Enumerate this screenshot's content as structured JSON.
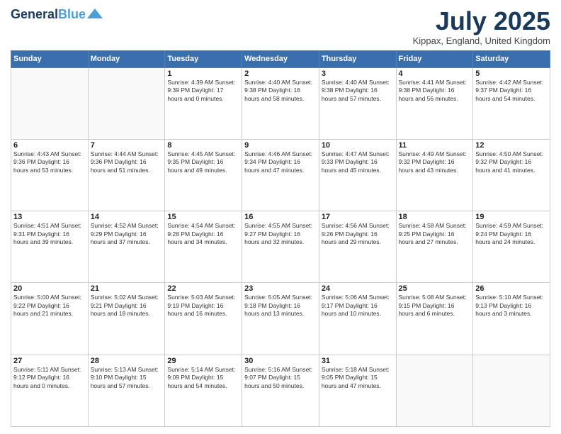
{
  "logo": {
    "line1": "General",
    "line2": "Blue"
  },
  "header": {
    "title": "July 2025",
    "location": "Kippax, England, United Kingdom"
  },
  "days_of_week": [
    "Sunday",
    "Monday",
    "Tuesday",
    "Wednesday",
    "Thursday",
    "Friday",
    "Saturday"
  ],
  "weeks": [
    [
      {
        "day": "",
        "text": ""
      },
      {
        "day": "",
        "text": ""
      },
      {
        "day": "1",
        "text": "Sunrise: 4:39 AM\nSunset: 9:39 PM\nDaylight: 17 hours\nand 0 minutes."
      },
      {
        "day": "2",
        "text": "Sunrise: 4:40 AM\nSunset: 9:38 PM\nDaylight: 16 hours\nand 58 minutes."
      },
      {
        "day": "3",
        "text": "Sunrise: 4:40 AM\nSunset: 9:38 PM\nDaylight: 16 hours\nand 57 minutes."
      },
      {
        "day": "4",
        "text": "Sunrise: 4:41 AM\nSunset: 9:38 PM\nDaylight: 16 hours\nand 56 minutes."
      },
      {
        "day": "5",
        "text": "Sunrise: 4:42 AM\nSunset: 9:37 PM\nDaylight: 16 hours\nand 54 minutes."
      }
    ],
    [
      {
        "day": "6",
        "text": "Sunrise: 4:43 AM\nSunset: 9:36 PM\nDaylight: 16 hours\nand 53 minutes."
      },
      {
        "day": "7",
        "text": "Sunrise: 4:44 AM\nSunset: 9:36 PM\nDaylight: 16 hours\nand 51 minutes."
      },
      {
        "day": "8",
        "text": "Sunrise: 4:45 AM\nSunset: 9:35 PM\nDaylight: 16 hours\nand 49 minutes."
      },
      {
        "day": "9",
        "text": "Sunrise: 4:46 AM\nSunset: 9:34 PM\nDaylight: 16 hours\nand 47 minutes."
      },
      {
        "day": "10",
        "text": "Sunrise: 4:47 AM\nSunset: 9:33 PM\nDaylight: 16 hours\nand 45 minutes."
      },
      {
        "day": "11",
        "text": "Sunrise: 4:49 AM\nSunset: 9:32 PM\nDaylight: 16 hours\nand 43 minutes."
      },
      {
        "day": "12",
        "text": "Sunrise: 4:50 AM\nSunset: 9:32 PM\nDaylight: 16 hours\nand 41 minutes."
      }
    ],
    [
      {
        "day": "13",
        "text": "Sunrise: 4:51 AM\nSunset: 9:31 PM\nDaylight: 16 hours\nand 39 minutes."
      },
      {
        "day": "14",
        "text": "Sunrise: 4:52 AM\nSunset: 9:29 PM\nDaylight: 16 hours\nand 37 minutes."
      },
      {
        "day": "15",
        "text": "Sunrise: 4:54 AM\nSunset: 9:28 PM\nDaylight: 16 hours\nand 34 minutes."
      },
      {
        "day": "16",
        "text": "Sunrise: 4:55 AM\nSunset: 9:27 PM\nDaylight: 16 hours\nand 32 minutes."
      },
      {
        "day": "17",
        "text": "Sunrise: 4:56 AM\nSunset: 9:26 PM\nDaylight: 16 hours\nand 29 minutes."
      },
      {
        "day": "18",
        "text": "Sunrise: 4:58 AM\nSunset: 9:25 PM\nDaylight: 16 hours\nand 27 minutes."
      },
      {
        "day": "19",
        "text": "Sunrise: 4:59 AM\nSunset: 9:24 PM\nDaylight: 16 hours\nand 24 minutes."
      }
    ],
    [
      {
        "day": "20",
        "text": "Sunrise: 5:00 AM\nSunset: 9:22 PM\nDaylight: 16 hours\nand 21 minutes."
      },
      {
        "day": "21",
        "text": "Sunrise: 5:02 AM\nSunset: 9:21 PM\nDaylight: 16 hours\nand 18 minutes."
      },
      {
        "day": "22",
        "text": "Sunrise: 5:03 AM\nSunset: 9:19 PM\nDaylight: 16 hours\nand 16 minutes."
      },
      {
        "day": "23",
        "text": "Sunrise: 5:05 AM\nSunset: 9:18 PM\nDaylight: 16 hours\nand 13 minutes."
      },
      {
        "day": "24",
        "text": "Sunrise: 5:06 AM\nSunset: 9:17 PM\nDaylight: 16 hours\nand 10 minutes."
      },
      {
        "day": "25",
        "text": "Sunrise: 5:08 AM\nSunset: 9:15 PM\nDaylight: 16 hours\nand 6 minutes."
      },
      {
        "day": "26",
        "text": "Sunrise: 5:10 AM\nSunset: 9:13 PM\nDaylight: 16 hours\nand 3 minutes."
      }
    ],
    [
      {
        "day": "27",
        "text": "Sunrise: 5:11 AM\nSunset: 9:12 PM\nDaylight: 16 hours\nand 0 minutes."
      },
      {
        "day": "28",
        "text": "Sunrise: 5:13 AM\nSunset: 9:10 PM\nDaylight: 15 hours\nand 57 minutes."
      },
      {
        "day": "29",
        "text": "Sunrise: 5:14 AM\nSunset: 9:09 PM\nDaylight: 15 hours\nand 54 minutes."
      },
      {
        "day": "30",
        "text": "Sunrise: 5:16 AM\nSunset: 9:07 PM\nDaylight: 15 hours\nand 50 minutes."
      },
      {
        "day": "31",
        "text": "Sunrise: 5:18 AM\nSunset: 9:05 PM\nDaylight: 15 hours\nand 47 minutes."
      },
      {
        "day": "",
        "text": ""
      },
      {
        "day": "",
        "text": ""
      }
    ]
  ]
}
